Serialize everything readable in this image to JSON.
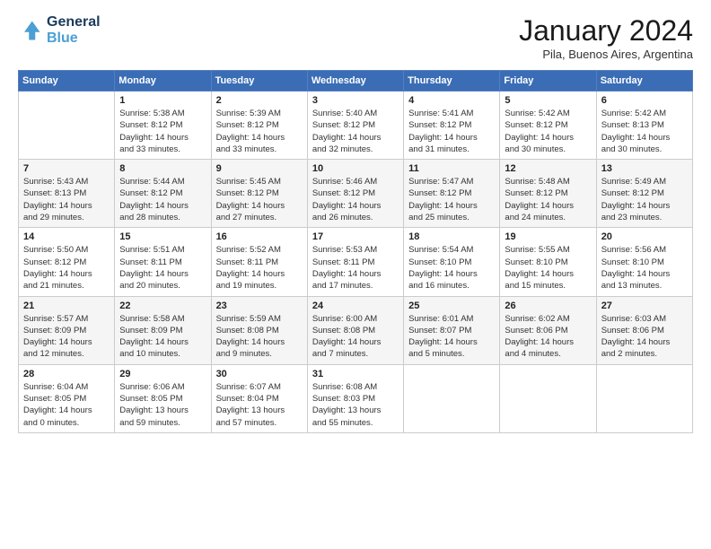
{
  "logo": {
    "line1": "General",
    "line2": "Blue"
  },
  "title": "January 2024",
  "location": "Pila, Buenos Aires, Argentina",
  "weekdays": [
    "Sunday",
    "Monday",
    "Tuesday",
    "Wednesday",
    "Thursday",
    "Friday",
    "Saturday"
  ],
  "weeks": [
    [
      {
        "day": "",
        "info": ""
      },
      {
        "day": "1",
        "info": "Sunrise: 5:38 AM\nSunset: 8:12 PM\nDaylight: 14 hours\nand 33 minutes."
      },
      {
        "day": "2",
        "info": "Sunrise: 5:39 AM\nSunset: 8:12 PM\nDaylight: 14 hours\nand 33 minutes."
      },
      {
        "day": "3",
        "info": "Sunrise: 5:40 AM\nSunset: 8:12 PM\nDaylight: 14 hours\nand 32 minutes."
      },
      {
        "day": "4",
        "info": "Sunrise: 5:41 AM\nSunset: 8:12 PM\nDaylight: 14 hours\nand 31 minutes."
      },
      {
        "day": "5",
        "info": "Sunrise: 5:42 AM\nSunset: 8:12 PM\nDaylight: 14 hours\nand 30 minutes."
      },
      {
        "day": "6",
        "info": "Sunrise: 5:42 AM\nSunset: 8:13 PM\nDaylight: 14 hours\nand 30 minutes."
      }
    ],
    [
      {
        "day": "7",
        "info": "Sunrise: 5:43 AM\nSunset: 8:13 PM\nDaylight: 14 hours\nand 29 minutes."
      },
      {
        "day": "8",
        "info": "Sunrise: 5:44 AM\nSunset: 8:12 PM\nDaylight: 14 hours\nand 28 minutes."
      },
      {
        "day": "9",
        "info": "Sunrise: 5:45 AM\nSunset: 8:12 PM\nDaylight: 14 hours\nand 27 minutes."
      },
      {
        "day": "10",
        "info": "Sunrise: 5:46 AM\nSunset: 8:12 PM\nDaylight: 14 hours\nand 26 minutes."
      },
      {
        "day": "11",
        "info": "Sunrise: 5:47 AM\nSunset: 8:12 PM\nDaylight: 14 hours\nand 25 minutes."
      },
      {
        "day": "12",
        "info": "Sunrise: 5:48 AM\nSunset: 8:12 PM\nDaylight: 14 hours\nand 24 minutes."
      },
      {
        "day": "13",
        "info": "Sunrise: 5:49 AM\nSunset: 8:12 PM\nDaylight: 14 hours\nand 23 minutes."
      }
    ],
    [
      {
        "day": "14",
        "info": "Sunrise: 5:50 AM\nSunset: 8:12 PM\nDaylight: 14 hours\nand 21 minutes."
      },
      {
        "day": "15",
        "info": "Sunrise: 5:51 AM\nSunset: 8:11 PM\nDaylight: 14 hours\nand 20 minutes."
      },
      {
        "day": "16",
        "info": "Sunrise: 5:52 AM\nSunset: 8:11 PM\nDaylight: 14 hours\nand 19 minutes."
      },
      {
        "day": "17",
        "info": "Sunrise: 5:53 AM\nSunset: 8:11 PM\nDaylight: 14 hours\nand 17 minutes."
      },
      {
        "day": "18",
        "info": "Sunrise: 5:54 AM\nSunset: 8:10 PM\nDaylight: 14 hours\nand 16 minutes."
      },
      {
        "day": "19",
        "info": "Sunrise: 5:55 AM\nSunset: 8:10 PM\nDaylight: 14 hours\nand 15 minutes."
      },
      {
        "day": "20",
        "info": "Sunrise: 5:56 AM\nSunset: 8:10 PM\nDaylight: 14 hours\nand 13 minutes."
      }
    ],
    [
      {
        "day": "21",
        "info": "Sunrise: 5:57 AM\nSunset: 8:09 PM\nDaylight: 14 hours\nand 12 minutes."
      },
      {
        "day": "22",
        "info": "Sunrise: 5:58 AM\nSunset: 8:09 PM\nDaylight: 14 hours\nand 10 minutes."
      },
      {
        "day": "23",
        "info": "Sunrise: 5:59 AM\nSunset: 8:08 PM\nDaylight: 14 hours\nand 9 minutes."
      },
      {
        "day": "24",
        "info": "Sunrise: 6:00 AM\nSunset: 8:08 PM\nDaylight: 14 hours\nand 7 minutes."
      },
      {
        "day": "25",
        "info": "Sunrise: 6:01 AM\nSunset: 8:07 PM\nDaylight: 14 hours\nand 5 minutes."
      },
      {
        "day": "26",
        "info": "Sunrise: 6:02 AM\nSunset: 8:06 PM\nDaylight: 14 hours\nand 4 minutes."
      },
      {
        "day": "27",
        "info": "Sunrise: 6:03 AM\nSunset: 8:06 PM\nDaylight: 14 hours\nand 2 minutes."
      }
    ],
    [
      {
        "day": "28",
        "info": "Sunrise: 6:04 AM\nSunset: 8:05 PM\nDaylight: 14 hours\nand 0 minutes."
      },
      {
        "day": "29",
        "info": "Sunrise: 6:06 AM\nSunset: 8:05 PM\nDaylight: 13 hours\nand 59 minutes."
      },
      {
        "day": "30",
        "info": "Sunrise: 6:07 AM\nSunset: 8:04 PM\nDaylight: 13 hours\nand 57 minutes."
      },
      {
        "day": "31",
        "info": "Sunrise: 6:08 AM\nSunset: 8:03 PM\nDaylight: 13 hours\nand 55 minutes."
      },
      {
        "day": "",
        "info": ""
      },
      {
        "day": "",
        "info": ""
      },
      {
        "day": "",
        "info": ""
      }
    ]
  ]
}
